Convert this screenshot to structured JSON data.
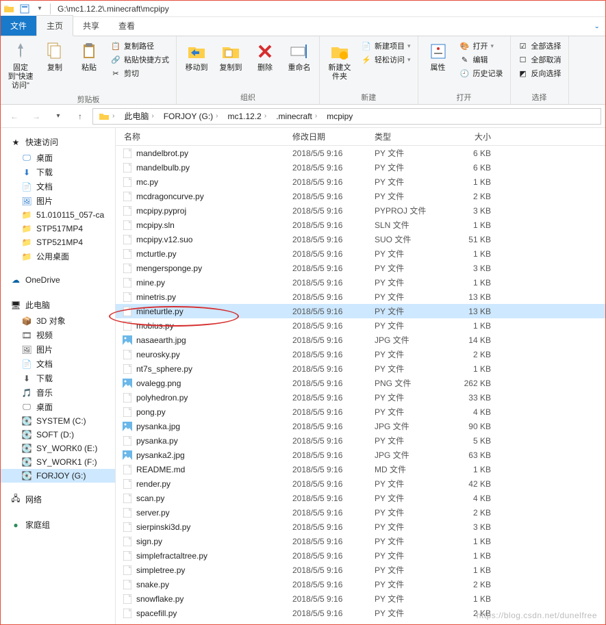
{
  "title": "G:\\mc1.12.2\\.minecraft\\mcpipy",
  "tabs": {
    "file": "文件",
    "home": "主页",
    "share": "共享",
    "view": "查看"
  },
  "ribbon": {
    "pin": "固定到\"快速访问\"",
    "copy": "复制",
    "paste": "粘贴",
    "copyPath": "复制路径",
    "pasteShortcut": "粘贴快捷方式",
    "cut": "剪切",
    "clipboard": "剪贴板",
    "moveTo": "移动到",
    "copyTo": "复制到",
    "delete": "删除",
    "rename": "重命名",
    "organize": "组织",
    "newFolder": "新建文件夹",
    "newItem": "新建项目",
    "easyAccess": "轻松访问",
    "newGroup": "新建",
    "properties": "属性",
    "open": "打开",
    "edit": "编辑",
    "history": "历史记录",
    "openGroup": "打开",
    "selectAll": "全部选择",
    "selectNone": "全部取消",
    "invert": "反向选择",
    "selectGroup": "选择"
  },
  "breadcrumbs": [
    "此电脑",
    "FORJOY (G:)",
    "mc1.12.2",
    ".minecraft",
    "mcpipy"
  ],
  "sidebar": {
    "quick": {
      "label": "快速访问",
      "items": [
        "桌面",
        "下载",
        "文档",
        "图片",
        "51.010115_057-ca",
        "STP517MP4",
        "STP521MP4",
        "公用桌面"
      ]
    },
    "onedrive": "OneDrive",
    "pc": {
      "label": "此电脑",
      "items": [
        "3D 对象",
        "视频",
        "图片",
        "文档",
        "下载",
        "音乐",
        "桌面",
        "SYSTEM (C:)",
        "SOFT (D:)",
        "SY_WORK0 (E:)",
        "SY_WORK1 (F:)",
        "FORJOY (G:)"
      ]
    },
    "network": "网络",
    "homegroup": "家庭组"
  },
  "columns": {
    "name": "名称",
    "date": "修改日期",
    "type": "类型",
    "size": "大小"
  },
  "files": [
    {
      "n": "mandelbrot.py",
      "d": "2018/5/5 9:16",
      "t": "PY 文件",
      "s": "6 KB",
      "i": "file"
    },
    {
      "n": "mandelbulb.py",
      "d": "2018/5/5 9:16",
      "t": "PY 文件",
      "s": "6 KB",
      "i": "file"
    },
    {
      "n": "mc.py",
      "d": "2018/5/5 9:16",
      "t": "PY 文件",
      "s": "1 KB",
      "i": "file"
    },
    {
      "n": "mcdragoncurve.py",
      "d": "2018/5/5 9:16",
      "t": "PY 文件",
      "s": "2 KB",
      "i": "file"
    },
    {
      "n": "mcpipy.pyproj",
      "d": "2018/5/5 9:16",
      "t": "PYPROJ 文件",
      "s": "3 KB",
      "i": "file"
    },
    {
      "n": "mcpipy.sln",
      "d": "2018/5/5 9:16",
      "t": "SLN 文件",
      "s": "1 KB",
      "i": "file"
    },
    {
      "n": "mcpipy.v12.suo",
      "d": "2018/5/5 9:16",
      "t": "SUO 文件",
      "s": "51 KB",
      "i": "file"
    },
    {
      "n": "mcturtle.py",
      "d": "2018/5/5 9:16",
      "t": "PY 文件",
      "s": "1 KB",
      "i": "file"
    },
    {
      "n": "mengersponge.py",
      "d": "2018/5/5 9:16",
      "t": "PY 文件",
      "s": "3 KB",
      "i": "file"
    },
    {
      "n": "mine.py",
      "d": "2018/5/5 9:16",
      "t": "PY 文件",
      "s": "1 KB",
      "i": "file"
    },
    {
      "n": "minetris.py",
      "d": "2018/5/5 9:16",
      "t": "PY 文件",
      "s": "13 KB",
      "i": "file"
    },
    {
      "n": "mineturtle.py",
      "d": "2018/5/5 9:16",
      "t": "PY 文件",
      "s": "13 KB",
      "i": "file",
      "sel": true
    },
    {
      "n": "mobius.py",
      "d": "2018/5/5 9:16",
      "t": "PY 文件",
      "s": "1 KB",
      "i": "file"
    },
    {
      "n": "nasaearth.jpg",
      "d": "2018/5/5 9:16",
      "t": "JPG 文件",
      "s": "14 KB",
      "i": "img"
    },
    {
      "n": "neurosky.py",
      "d": "2018/5/5 9:16",
      "t": "PY 文件",
      "s": "2 KB",
      "i": "file"
    },
    {
      "n": "nt7s_sphere.py",
      "d": "2018/5/5 9:16",
      "t": "PY 文件",
      "s": "1 KB",
      "i": "file"
    },
    {
      "n": "ovalegg.png",
      "d": "2018/5/5 9:16",
      "t": "PNG 文件",
      "s": "262 KB",
      "i": "img"
    },
    {
      "n": "polyhedron.py",
      "d": "2018/5/5 9:16",
      "t": "PY 文件",
      "s": "33 KB",
      "i": "file"
    },
    {
      "n": "pong.py",
      "d": "2018/5/5 9:16",
      "t": "PY 文件",
      "s": "4 KB",
      "i": "file"
    },
    {
      "n": "pysanka.jpg",
      "d": "2018/5/5 9:16",
      "t": "JPG 文件",
      "s": "90 KB",
      "i": "img"
    },
    {
      "n": "pysanka.py",
      "d": "2018/5/5 9:16",
      "t": "PY 文件",
      "s": "5 KB",
      "i": "file"
    },
    {
      "n": "pysanka2.jpg",
      "d": "2018/5/5 9:16",
      "t": "JPG 文件",
      "s": "63 KB",
      "i": "img"
    },
    {
      "n": "README.md",
      "d": "2018/5/5 9:16",
      "t": "MD 文件",
      "s": "1 KB",
      "i": "file"
    },
    {
      "n": "render.py",
      "d": "2018/5/5 9:16",
      "t": "PY 文件",
      "s": "42 KB",
      "i": "file"
    },
    {
      "n": "scan.py",
      "d": "2018/5/5 9:16",
      "t": "PY 文件",
      "s": "4 KB",
      "i": "file"
    },
    {
      "n": "server.py",
      "d": "2018/5/5 9:16",
      "t": "PY 文件",
      "s": "2 KB",
      "i": "file"
    },
    {
      "n": "sierpinski3d.py",
      "d": "2018/5/5 9:16",
      "t": "PY 文件",
      "s": "3 KB",
      "i": "file"
    },
    {
      "n": "sign.py",
      "d": "2018/5/5 9:16",
      "t": "PY 文件",
      "s": "1 KB",
      "i": "file"
    },
    {
      "n": "simplefractaltree.py",
      "d": "2018/5/5 9:16",
      "t": "PY 文件",
      "s": "1 KB",
      "i": "file"
    },
    {
      "n": "simpletree.py",
      "d": "2018/5/5 9:16",
      "t": "PY 文件",
      "s": "1 KB",
      "i": "file"
    },
    {
      "n": "snake.py",
      "d": "2018/5/5 9:16",
      "t": "PY 文件",
      "s": "2 KB",
      "i": "file"
    },
    {
      "n": "snowflake.py",
      "d": "2018/5/5 9:16",
      "t": "PY 文件",
      "s": "1 KB",
      "i": "file"
    },
    {
      "n": "spacefill.py",
      "d": "2018/5/5 9:16",
      "t": "PY 文件",
      "s": "2 KB",
      "i": "file"
    }
  ],
  "watermark": "https://blog.csdn.net/dunelfree"
}
